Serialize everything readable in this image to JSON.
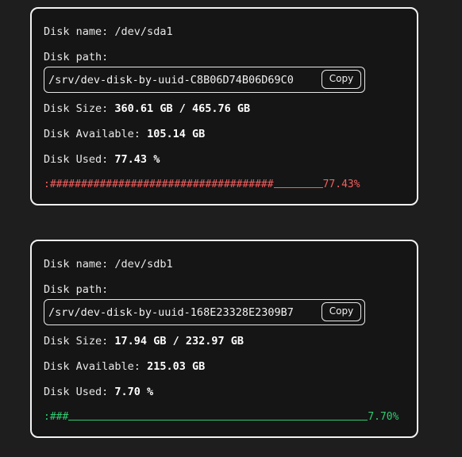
{
  "disks": [
    {
      "name_label": "Disk name:",
      "name": "/dev/sda1",
      "path_label": "Disk path:",
      "path": "/srv/dev-disk-by-uuid-C8B06D74B06D69C0",
      "copy_label": "Copy",
      "size_label": "Disk Size:",
      "size": "360.61 GB / 465.76 GB",
      "available_label": "Disk Available:",
      "available": "105.14 GB",
      "used_label": "Disk Used:",
      "used": "77.43 %",
      "bar_prefix": ":",
      "bar_hashes": "####################################",
      "bar_percent": "77.43%",
      "bar_color": "#f0605f",
      "used_fraction": 0.7743
    },
    {
      "name_label": "Disk name:",
      "name": "/dev/sdb1",
      "path_label": "Disk path:",
      "path": "/srv/dev-disk-by-uuid-168E23328E2309B7",
      "copy_label": "Copy",
      "size_label": "Disk Size:",
      "size": "17.94 GB / 232.97 GB",
      "available_label": "Disk Available:",
      "available": "215.03 GB",
      "used_label": "Disk Used:",
      "used": "7.70 %",
      "bar_prefix": ":",
      "bar_hashes": "###",
      "bar_percent": "7.70%",
      "bar_color": "#2ecc71",
      "used_fraction": 0.077
    }
  ]
}
